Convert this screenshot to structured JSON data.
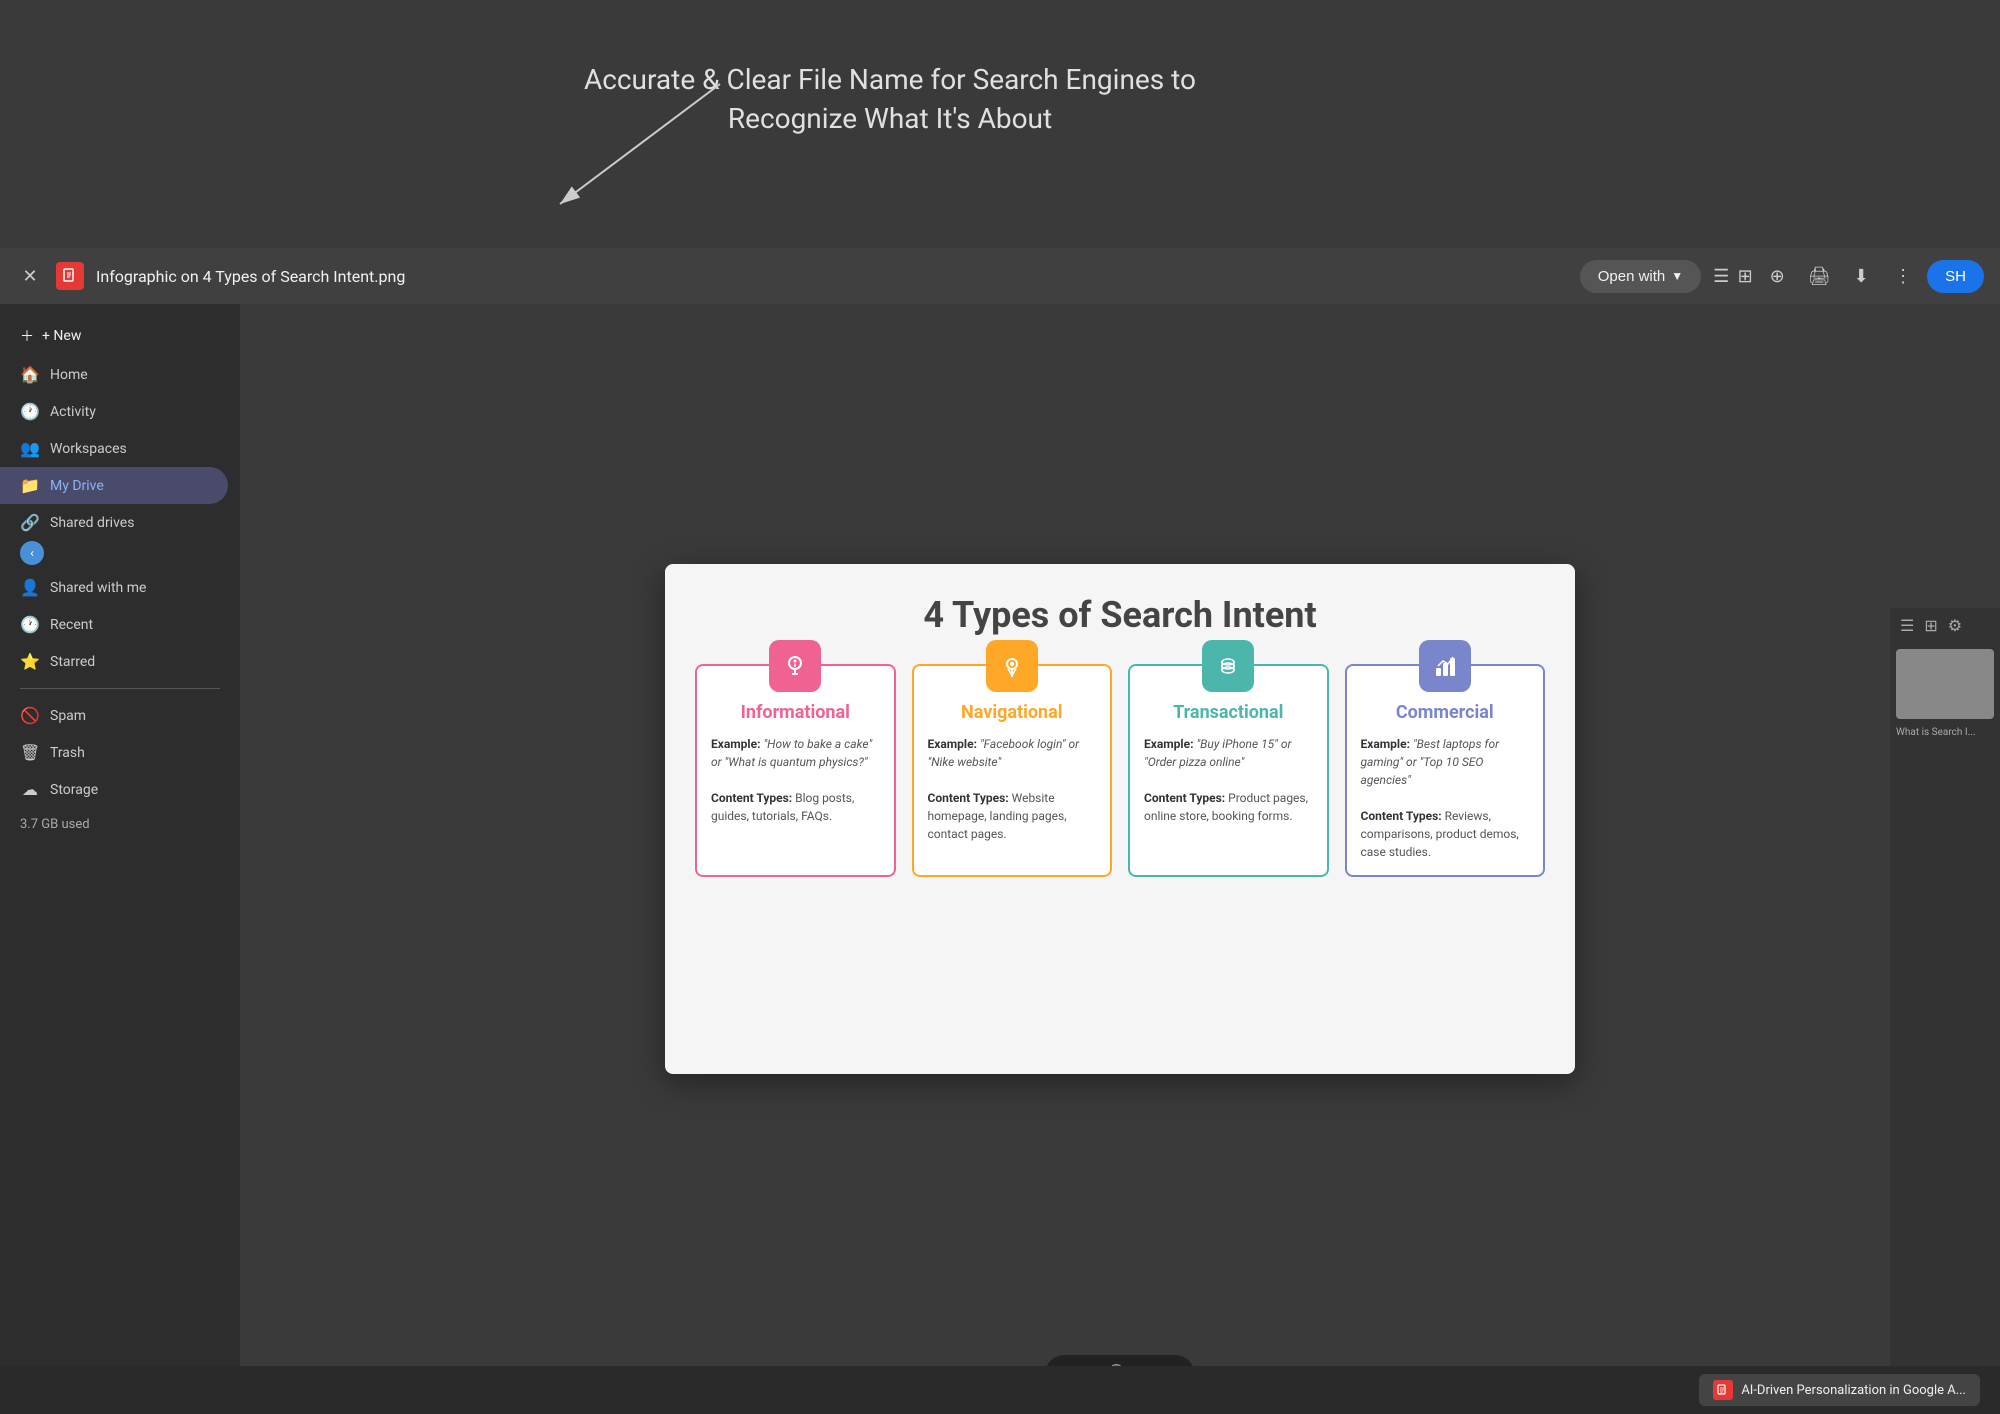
{
  "annotation": {
    "text": "Accurate & Clear File Name for Search Engines to\nRecognize What It's About"
  },
  "topbar": {
    "filename": "Infographic on 4 Types of Search Intent.png",
    "open_with_label": "Open with",
    "share_label": "SH"
  },
  "sidebar": {
    "new_label": "+ New",
    "items": [
      {
        "label": "Home",
        "icon": "🏠",
        "active": false
      },
      {
        "label": "Activity",
        "icon": "🕐",
        "active": false
      },
      {
        "label": "Workspaces",
        "icon": "👥",
        "active": false
      },
      {
        "label": "My Drive",
        "icon": "📁",
        "active": true
      },
      {
        "label": "Shared drives",
        "icon": "🔗",
        "active": false
      },
      {
        "label": "Shared with me",
        "icon": "👤",
        "active": false
      },
      {
        "label": "Recent",
        "icon": "🕐",
        "active": false
      },
      {
        "label": "Starred",
        "icon": "⭐",
        "active": false
      },
      {
        "label": "Spam",
        "icon": "🚫",
        "active": false
      },
      {
        "label": "Trash",
        "icon": "🗑",
        "active": false
      },
      {
        "label": "Storage",
        "icon": "☁",
        "active": false
      }
    ],
    "storage_label": "3.7 GB used"
  },
  "infographic": {
    "title": "4 Types of Search Intent",
    "cards": [
      {
        "type": "informational",
        "title": "Informational",
        "icon": "💡",
        "example_label": "Example:",
        "example_text": "\"How to bake a cake\" or \"What is quantum physics?\"",
        "content_types_label": "Content Types:",
        "content_types_text": "Blog posts, guides, tutorials, FAQs."
      },
      {
        "type": "navigational",
        "title": "Navigational",
        "icon": "📍",
        "example_label": "Example:",
        "example_text": "\"Facebook login\" or \"Nike website\"",
        "content_types_label": "Content Types:",
        "content_types_text": "Website homepage, landing pages, contact pages."
      },
      {
        "type": "transactional",
        "title": "Transactional",
        "icon": "💰",
        "example_label": "Example:",
        "example_text": "\"Buy iPhone 15\" or \"Order pizza online\"",
        "content_types_label": "Content Types:",
        "content_types_text": "Product pages, online store, booking forms."
      },
      {
        "type": "commercial",
        "title": "Commercial",
        "icon": "📊",
        "example_label": "Example:",
        "example_text": "\"Best laptops for gaming\" or \"Top 10 SEO agencies\"",
        "content_types_label": "Content Types:",
        "content_types_text": "Reviews, comparisons, product demos, case studies."
      }
    ]
  },
  "zoom": {
    "minus": "−",
    "plus": "+",
    "icon": "🔍"
  },
  "bottom_notification": {
    "text": "AI-Driven Personalization in Google A..."
  }
}
